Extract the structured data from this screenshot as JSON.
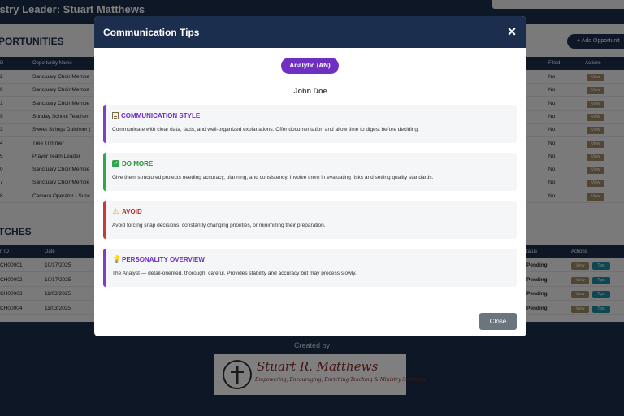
{
  "header": {
    "title": "istry Leader: Stuart Matthews"
  },
  "opportunities": {
    "title": "PORTUNITIES",
    "add_button": "+ Add Opportunit",
    "columns": {
      "id": "D",
      "name": "Opportunity Name",
      "filled": "Filled",
      "actions": "Actions"
    },
    "rows": [
      {
        "id": "2",
        "name": "Sanctuary Choir Membe",
        "filled": "No",
        "action": "View"
      },
      {
        "id": "0",
        "name": "Sanctuary Choir Membe",
        "filled": "No",
        "action": "View"
      },
      {
        "id": "1",
        "name": "Sanctuary Choir Membe",
        "filled": "No",
        "action": "View"
      },
      {
        "id": "9",
        "name": "Sunday School Teacher-",
        "filled": "No",
        "action": "View"
      },
      {
        "id": "3",
        "name": "Sweet Strings Dulcimer (",
        "filled": "No",
        "action": "View"
      },
      {
        "id": "4",
        "name": "Tree Trimmer",
        "filled": "No",
        "action": "View"
      },
      {
        "id": "5",
        "name": "Prayer Team Leader",
        "filled": "No",
        "action": "View"
      },
      {
        "id": "0",
        "name": "Sanctuary Choir Membe",
        "filled": "No",
        "action": "View"
      },
      {
        "id": "7",
        "name": "Sanctuary Choir Membe",
        "filled": "No",
        "action": "View"
      },
      {
        "id": "8",
        "name": "Camera Operator - Sunc",
        "filled": "No",
        "action": "View"
      }
    ]
  },
  "batches": {
    "title": "TCHES",
    "columns": {
      "id": "n ID",
      "date": "Date",
      "status": "tatus",
      "actions": "Actions"
    },
    "rows": [
      {
        "id": "CH00001",
        "date": "10/17/2025",
        "status": "Pending",
        "view": "View",
        "tips": "Tips"
      },
      {
        "id": "CH00002",
        "date": "10/17/2025",
        "status": "Pending",
        "view": "View",
        "tips": "Tips"
      },
      {
        "id": "CH00003",
        "date": "11/03/2025",
        "status": "Pending",
        "view": "View",
        "tips": "Tips"
      },
      {
        "id": "CH00004",
        "date": "11/03/2025",
        "status": "Pending",
        "view": "View",
        "tips": "Tips"
      }
    ]
  },
  "footer": {
    "created_by": "Created by",
    "logo_name": "Stuart R. Matthews",
    "logo_tagline": "Empowering, Encouraging, Enriching Teaching & Ministry Solutions"
  },
  "modal": {
    "title": "Communication Tips",
    "close_x": "×",
    "badge": "Analytic (AN)",
    "person": "John Doe",
    "sections": [
      {
        "icon": "document-icon",
        "heading": "COMMUNICATION STYLE",
        "body": "Communicate with clear data, facts, and well-organized explanations. Offer documentation and allow time to digest before deciding."
      },
      {
        "icon": "check-icon",
        "heading": "DO MORE",
        "body": "Give them structured projects needing accuracy, planning, and consistency. Involve them in evaluating risks and setting quality standards."
      },
      {
        "icon": "warning-icon",
        "heading": "AVOID",
        "body": "Avoid forcing snap decisions, constantly changing priorities, or minimizing their preparation."
      },
      {
        "icon": "lightbulb-icon",
        "heading": "PERSONALITY OVERVIEW",
        "body": "The Analyst — detail-oriented, thorough, careful. Provides stability and accuracy but may process slowly."
      }
    ],
    "close_button": "Close"
  },
  "colors": {
    "navy": "#1c2e4d",
    "purple": "#6f2fc2",
    "green": "#2fa84a",
    "red": "#c83a3a",
    "gray_button": "#6c757d",
    "view_chip": "#a38c68",
    "tips_chip": "#1d8fa6"
  }
}
